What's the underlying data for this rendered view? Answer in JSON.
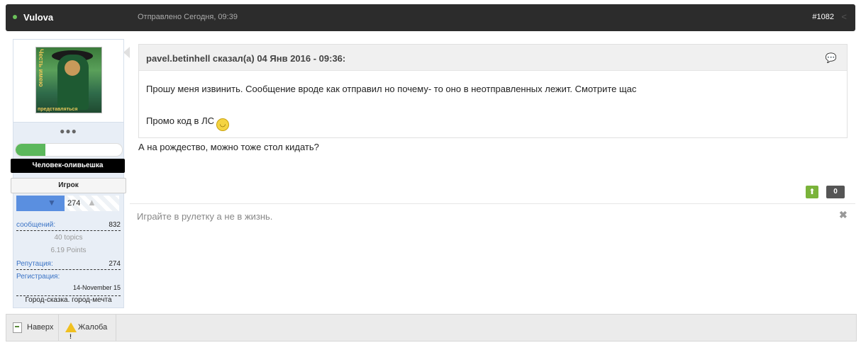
{
  "post": {
    "author": "Vulova",
    "date": "Отправлено Сегодня, 09:39",
    "number": "#1082",
    "text": "А на рождество, можно тоже стол кидать?",
    "signature": "Играйте в рулетку а не в жизнь.",
    "vote_count": "0"
  },
  "user": {
    "avatar_text_side": "Честь имею",
    "avatar_text_bottom": "представляться",
    "dots": "●●●",
    "progress": 0.28,
    "rank_title": "Человек-оливьешка",
    "group": "Игрок",
    "reputation_bar_value": "274",
    "stats": {
      "messages_label": "сообщений:",
      "messages_value": "832",
      "topics": "40 topics",
      "points": "6.19 Points",
      "reputation_label": "Репутация:",
      "reputation_value": "274",
      "registration_label": "Регистрация:",
      "registration_date": "14-November 15"
    },
    "location": "Город-сказка. город-мечта"
  },
  "quote": {
    "citation": "pavel.betinhell сказал(а) 04 Янв 2016 - 09:36:",
    "line1": "Прошу меня извинить. Сообщение вроде как отправил но почему- то оно в неотправленных лежит. Смотрите щас",
    "line2": "Промо код в ЛС"
  },
  "footer": {
    "top_label": "Наверх",
    "report_label": "Жалоба"
  },
  "colors": {
    "header_bg": "#2c2c2c",
    "online": "#6bc15a",
    "link": "#3a73c5",
    "vote_up": "#7ab33a"
  },
  "icons": [
    "online-dot-icon",
    "share-icon",
    "thumb-down-icon",
    "thumb-up-icon",
    "multiquote-icon",
    "smiley-icon",
    "vote-up-icon",
    "close-icon",
    "page-top-icon",
    "warning-icon"
  ]
}
